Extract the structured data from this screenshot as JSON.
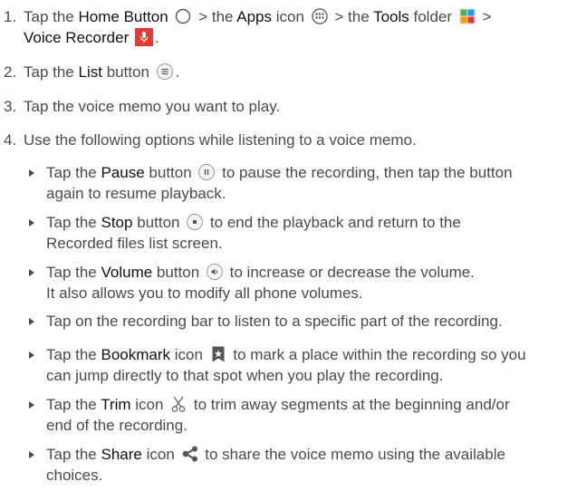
{
  "steps": [
    {
      "num": "1.",
      "parts": [
        "Tap the ",
        "Home Button",
        " > the ",
        "Apps",
        " icon ",
        " > the ",
        "Tools",
        " folder ",
        " >",
        "Voice Recorder",
        "."
      ]
    },
    {
      "num": "2.",
      "parts": [
        "Tap the ",
        "List",
        " button ",
        "."
      ]
    },
    {
      "num": "3.",
      "text": "Tap the voice memo you want to play."
    },
    {
      "num": "4.",
      "text": "Use the following options while listening to a voice memo."
    }
  ],
  "bullets": [
    {
      "parts": [
        "Tap the ",
        "Pause",
        " button ",
        " to pause the recording, then tap the button",
        "again to resume playback."
      ]
    },
    {
      "parts": [
        "Tap the ",
        "Stop",
        " button ",
        " to end the playback and return to the",
        "Recorded files list screen."
      ]
    },
    {
      "parts": [
        "Tap the ",
        "Volume",
        " button ",
        " to increase or decrease the volume.",
        "It also allows you to modify all phone volumes."
      ]
    },
    {
      "parts": [
        "Tap on the recording bar to listen to a specific part of the recording."
      ]
    },
    {
      "parts": [
        "Tap the ",
        "Bookmark",
        " icon ",
        " to mark a place within the recording so you",
        "can jump directly to that spot when you play the recording."
      ]
    },
    {
      "parts": [
        "Tap the ",
        "Trim",
        " icon ",
        " to trim away segments at the beginning and/or",
        "end of the recording."
      ]
    },
    {
      "parts": [
        "Tap the ",
        "Share",
        " icon ",
        " to share the voice memo using the available",
        "choices."
      ]
    }
  ],
  "icons": {
    "home": "home-button-icon",
    "apps": "apps-icon",
    "tools": "tools-folder-icon",
    "recorder": "voice-recorder-icon",
    "list": "list-button-icon",
    "pause": "pause-button-icon",
    "stop": "stop-button-icon",
    "volume": "volume-button-icon",
    "bookmark": "bookmark-icon",
    "trim": "trim-icon",
    "share": "share-icon"
  },
  "colors": {
    "text": "#4a4a4a",
    "keyword": "#111111",
    "recorder_red": "#e53935",
    "icon_gray": "#777777"
  }
}
